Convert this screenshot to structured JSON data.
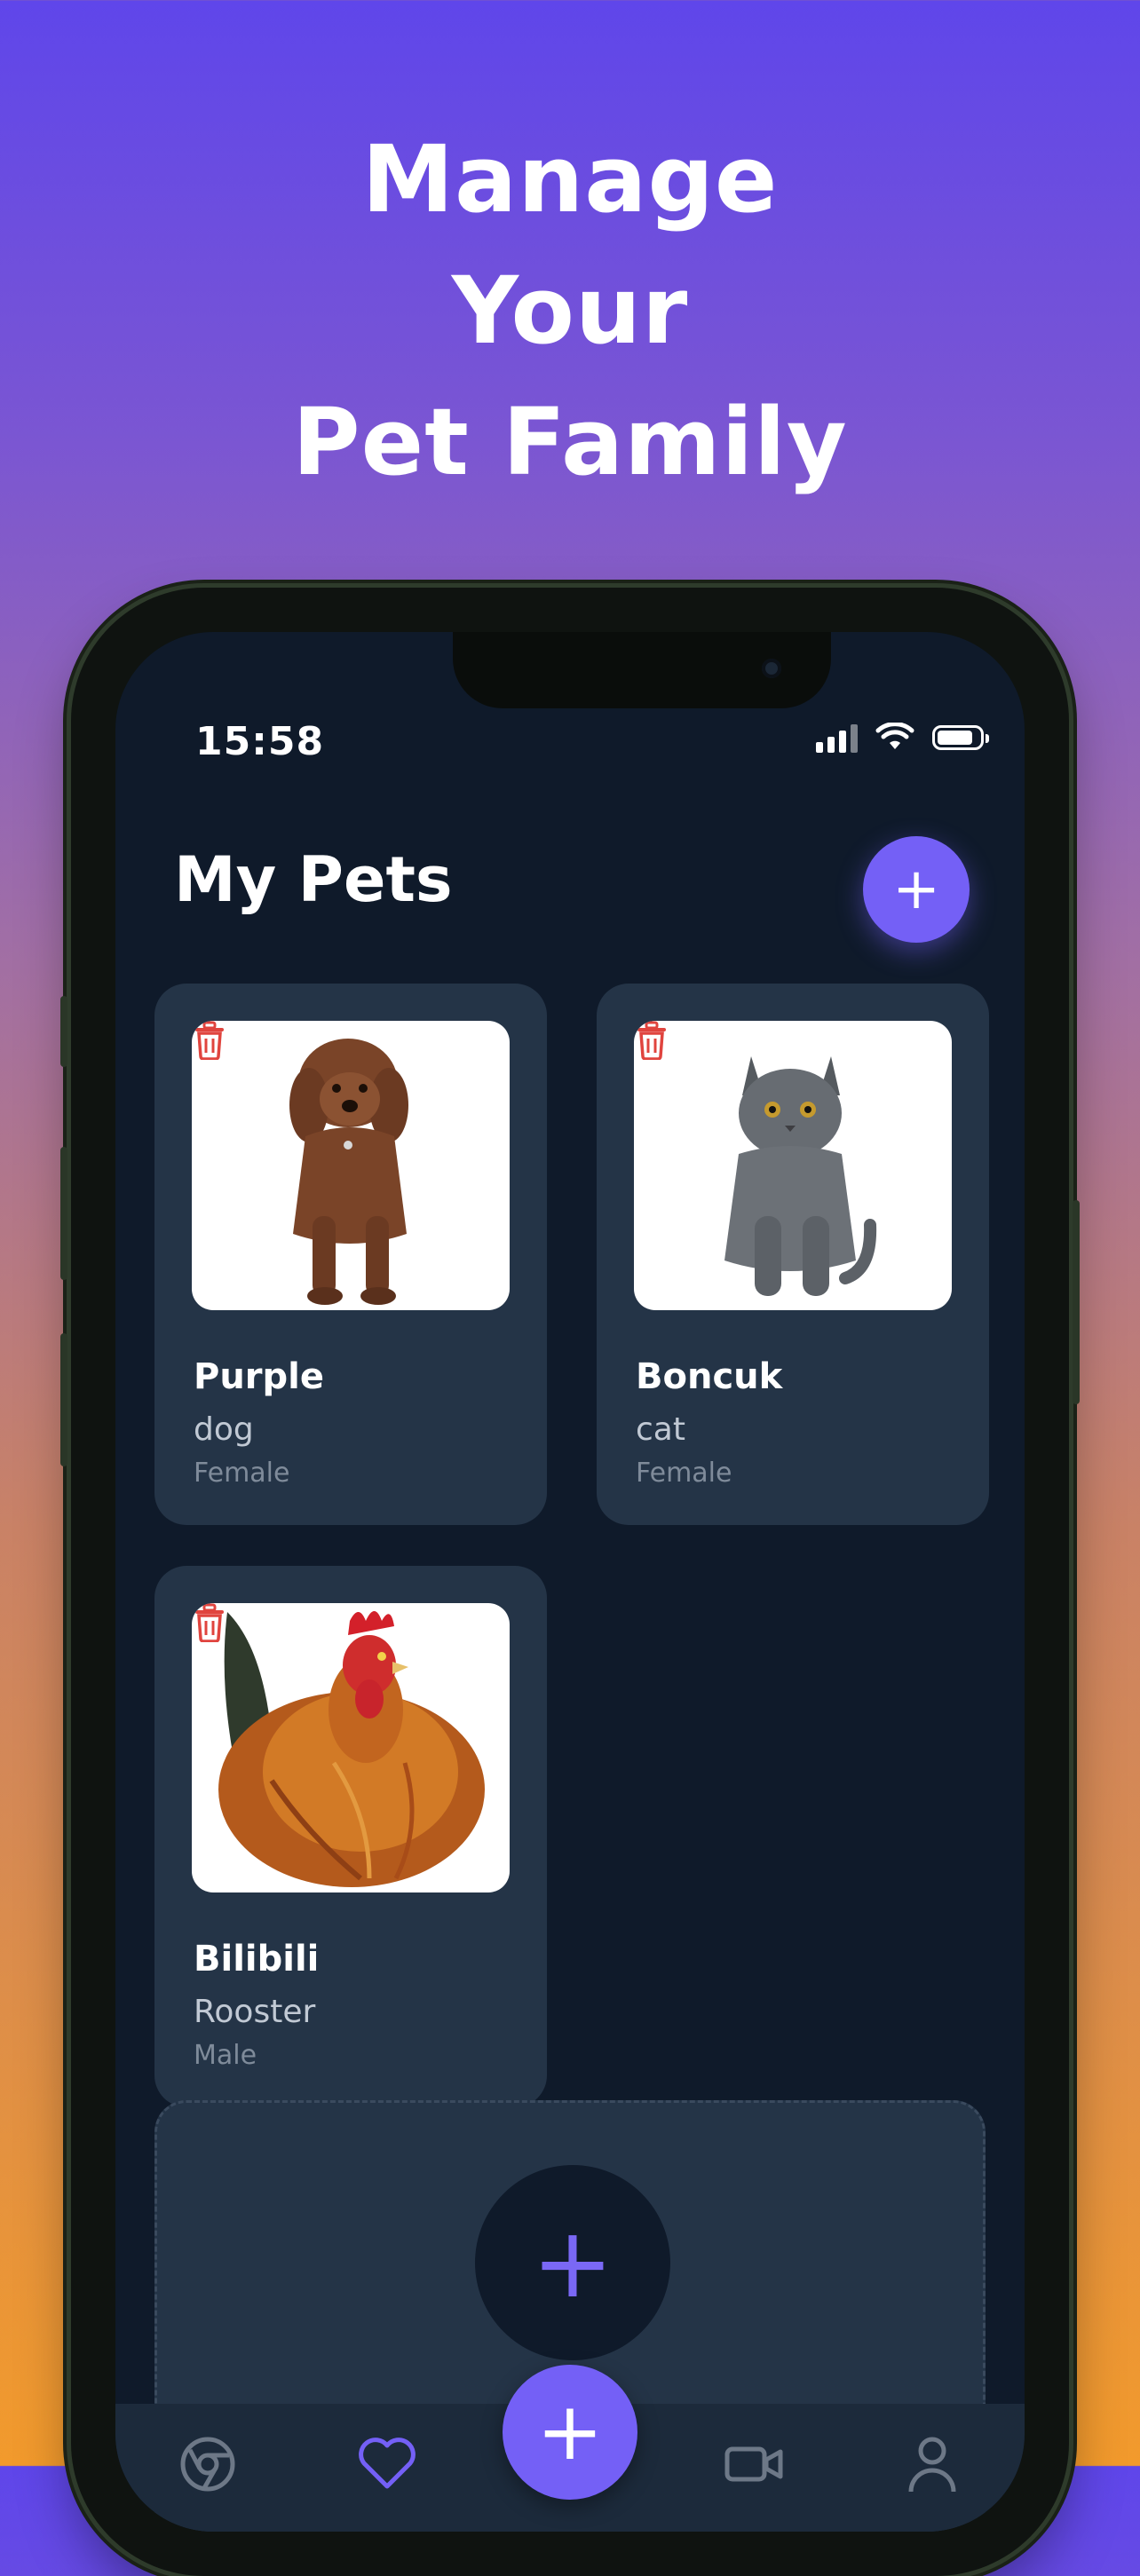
{
  "promo": {
    "line1": "Manage",
    "line2": "Your",
    "line3": "Pet Family"
  },
  "status_bar": {
    "time": "15:58"
  },
  "header": {
    "title": "My Pets",
    "add_label": "+"
  },
  "pets": [
    {
      "name": "Purple",
      "species": "dog",
      "gender": "Female"
    },
    {
      "name": "Boncuk",
      "species": "cat",
      "gender": "Female"
    },
    {
      "name": "Bilibili",
      "species": "Rooster",
      "gender": "Male"
    }
  ],
  "add_pet_panel": {
    "plus_label": "+"
  },
  "tab_bar": {
    "fab_label": "+",
    "tabs": [
      {
        "icon": "chrome-icon",
        "active": false
      },
      {
        "icon": "heart-icon",
        "active": true
      },
      {
        "icon": "video-icon",
        "active": false
      },
      {
        "icon": "person-icon",
        "active": false
      }
    ]
  },
  "colors": {
    "accent": "#7460f6",
    "screen_bg": "#0f1a2a",
    "card_bg": "#243447",
    "delete": "#e0443e"
  }
}
